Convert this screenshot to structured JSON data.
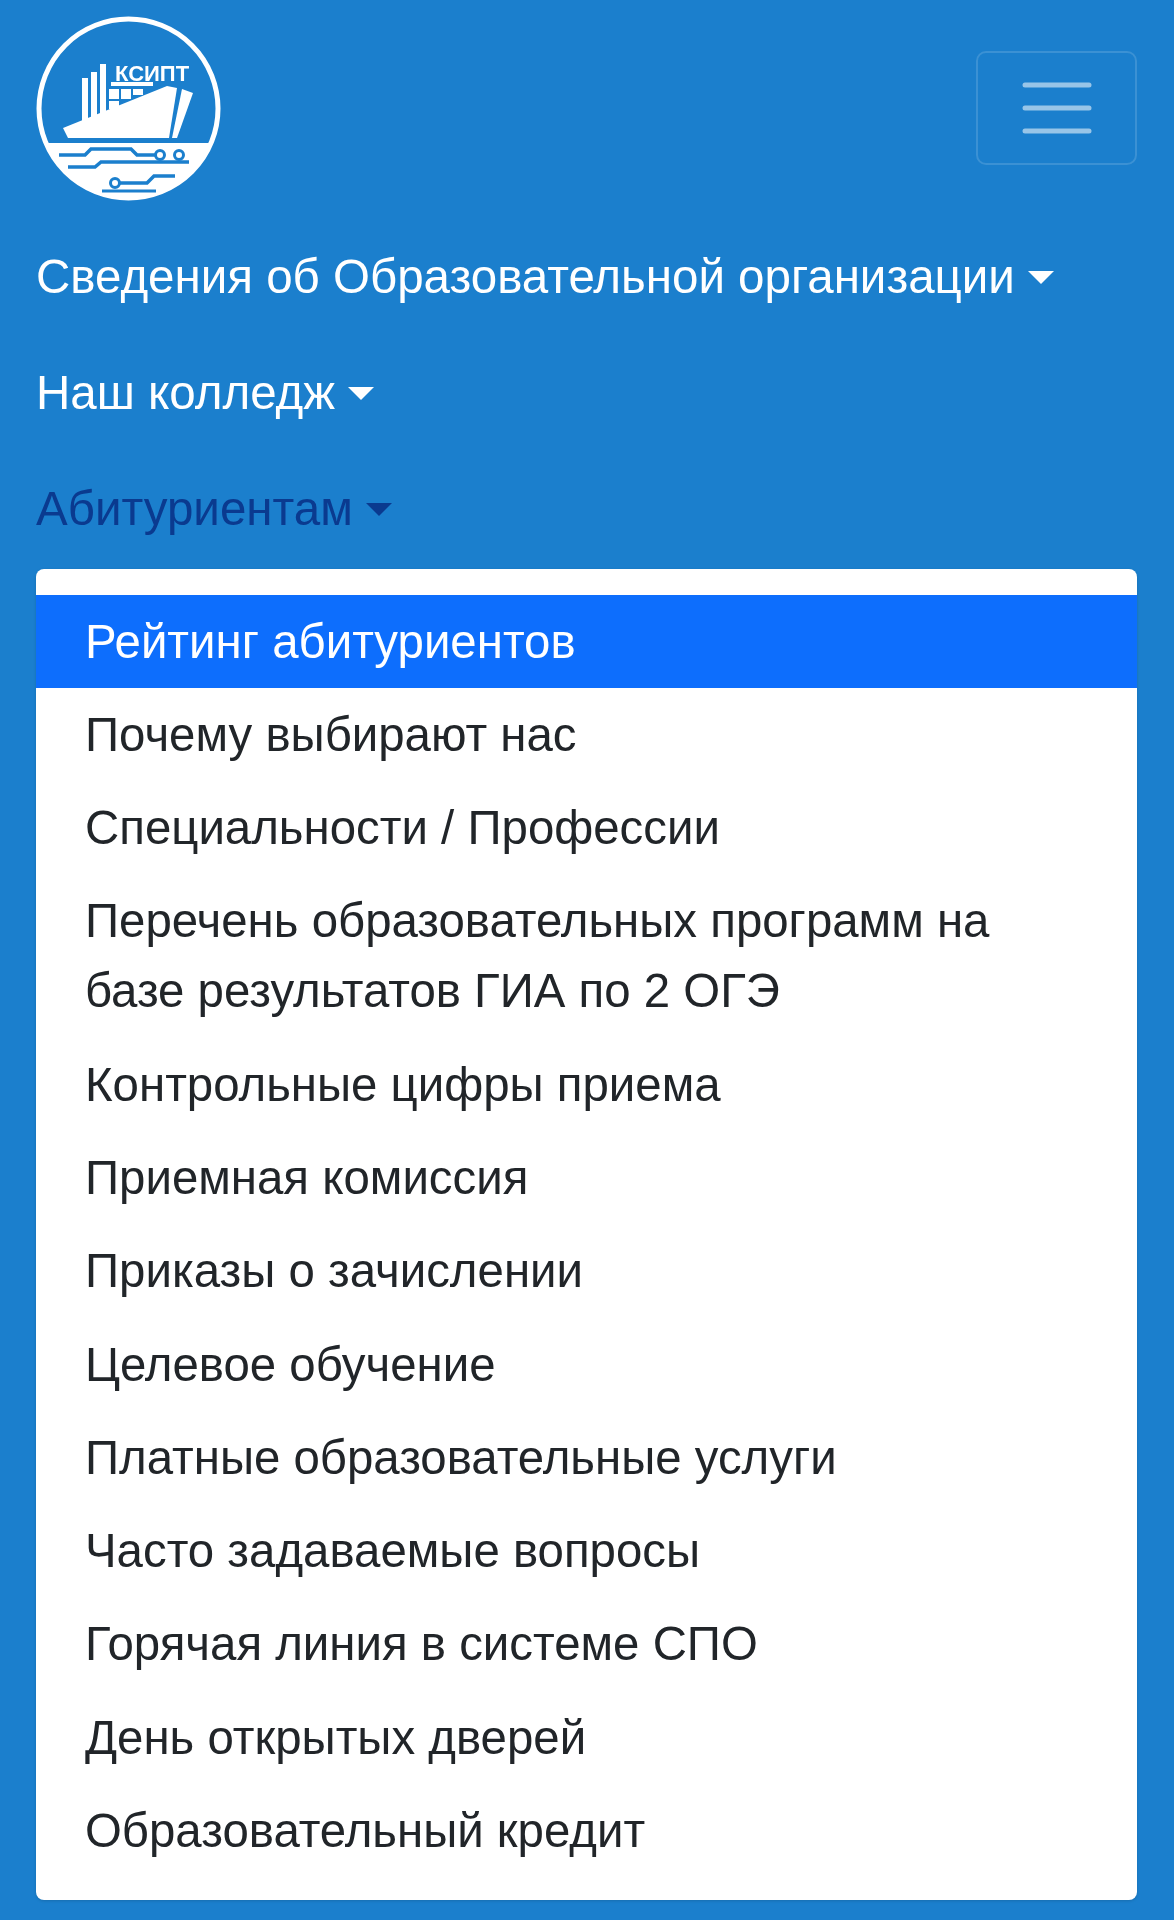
{
  "logo": {
    "text": "КСИПТ"
  },
  "nav": [
    {
      "label": "Сведения об Образовательной организации",
      "expanded": false
    },
    {
      "label": "Наш колледж",
      "expanded": false
    },
    {
      "label": "Абитуриентам",
      "expanded": true,
      "menu": [
        {
          "label": "Рейтинг абитуриентов",
          "selected": true
        },
        {
          "label": "Почему выбирают нас",
          "selected": false
        },
        {
          "label": "Специальности / Профессии",
          "selected": false
        },
        {
          "label": "Перечень образовательных программ на базе результатов ГИА по 2 ОГЭ",
          "selected": false
        },
        {
          "label": "Контрольные цифры приема",
          "selected": false
        },
        {
          "label": "Приемная комиссия",
          "selected": false
        },
        {
          "label": "Приказы о зачислении",
          "selected": false
        },
        {
          "label": "Целевое обучение",
          "selected": false
        },
        {
          "label": "Платные образовательные услуги",
          "selected": false
        },
        {
          "label": "Часто задаваемые вопросы",
          "selected": false
        },
        {
          "label": "Горячая линия в системе СПО",
          "selected": false
        },
        {
          "label": "День открытых дверей",
          "selected": false
        },
        {
          "label": "Образовательный кредит",
          "selected": false
        }
      ]
    }
  ]
}
